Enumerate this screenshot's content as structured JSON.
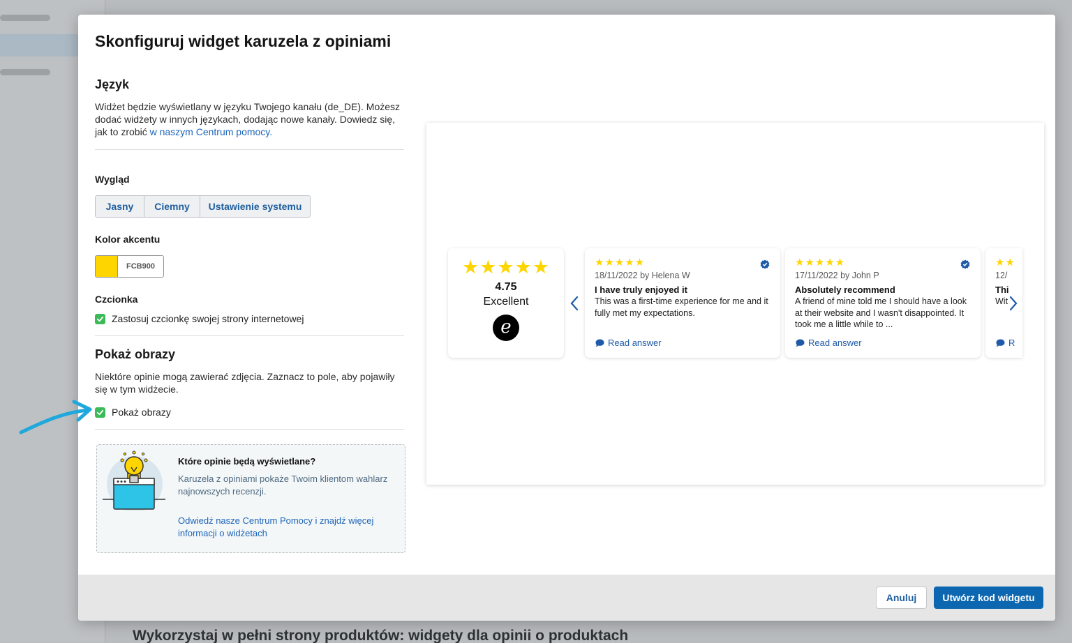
{
  "background": {
    "heading": "Wykorzystaj w pełni strony produktów: widgety dla opinii o produktach"
  },
  "modal": {
    "title": "Skonfiguruj widget karuzela z opiniami"
  },
  "language": {
    "heading": "Język",
    "text": "Widżet będzie wyświetlany w języku Twojego kanału (de_DE). Możesz dodać widżety w innych językach, dodając nowe kanały. Dowiedz się, jak to zrobić ",
    "link": "w naszym Centrum pomocy."
  },
  "appearance": {
    "label": "Wygląd",
    "options": [
      "Jasny",
      "Ciemny",
      "Ustawienie systemu"
    ]
  },
  "accent": {
    "label": "Kolor akcentu",
    "hex": "FCB900",
    "color": "#FFD500"
  },
  "font": {
    "label": "Czcionka",
    "checkbox_label": "Zastosuj czcionkę swojej strony internetowej"
  },
  "images": {
    "heading": "Pokaż obrazy",
    "text": "Niektóre opinie mogą zawierać zdjęcia. Zaznacz to pole, aby pojawiły się w tym widżecie.",
    "checkbox_label": "Pokaż obrazy"
  },
  "info": {
    "title": "Które opinie będą wyświetlane?",
    "text": "Karuzela z opiniami pokaże Twoim klientom wahlarz najnowszych recenzji.",
    "link": "Odwiedź nasze Centrum Pomocy i znajdź więcej informacji o widżetach"
  },
  "preview": {
    "summary": {
      "stars": "★★★★★",
      "rating": "4.75",
      "word": "Excellent"
    },
    "reviews": [
      {
        "stars": "★★★★★",
        "meta": "18/11/2022 by Helena W",
        "title": "I have truly enjoyed it",
        "body": "This was a first-time experience for me and it fully met my expectations.",
        "answer": "Read answer"
      },
      {
        "stars": "★★★★★",
        "meta": "17/11/2022 by John P",
        "title": "Absolutely recommend",
        "body": "A friend of mine told me I should have a look at their website and I wasn't disappointed. It took me a little while to ...",
        "answer": "Read answer"
      },
      {
        "stars": "★★",
        "meta": "12/",
        "title": "Thi",
        "body": "Wit",
        "answer": "R"
      }
    ],
    "star_color": "#FFD500",
    "link_color": "#1E5AA8"
  },
  "footer": {
    "cancel": "Anuluj",
    "create": "Utwórz kod widgetu"
  }
}
